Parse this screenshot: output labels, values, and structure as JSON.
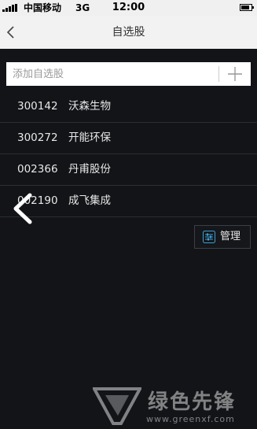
{
  "status_bar": {
    "carrier": "中国移动",
    "network": "3G",
    "time": "12:00"
  },
  "header": {
    "title": "自选股",
    "back_icon": "chevron-left-icon"
  },
  "search": {
    "placeholder": "添加自选股",
    "add_icon": "plus-icon"
  },
  "stocks": [
    {
      "code": "300142",
      "name": "沃森生物"
    },
    {
      "code": "300272",
      "name": "开能环保"
    },
    {
      "code": "002366",
      "name": "丹甫股份"
    },
    {
      "code": "002190",
      "name": "成飞集成"
    }
  ],
  "manage": {
    "label": "管理",
    "icon": "sliders-icon"
  },
  "watermark": {
    "text": "绿色先锋",
    "url": "www.greenxf.com"
  },
  "colors": {
    "background": "#121417",
    "header": "#f2f2f2",
    "divider": "#2b2e33",
    "accent": "#3aa0d8"
  }
}
